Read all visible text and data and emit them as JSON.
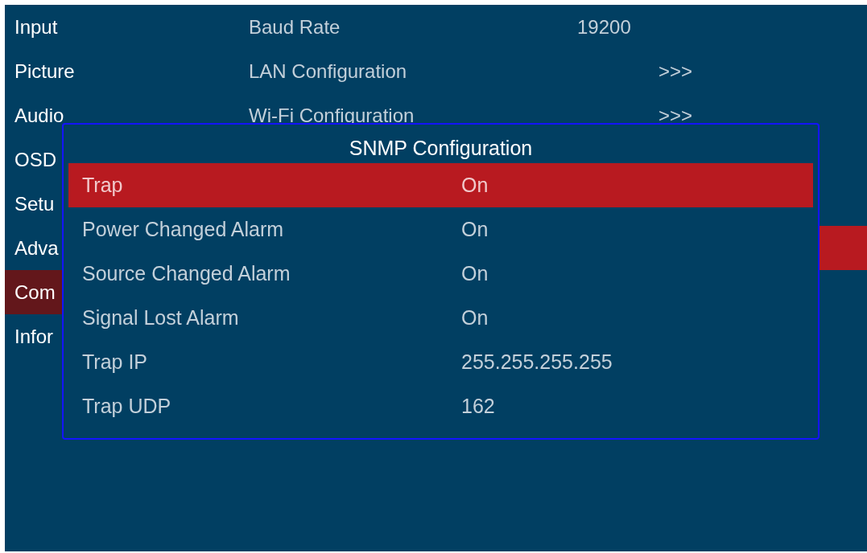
{
  "menu": [
    {
      "label": "Input",
      "selected": false
    },
    {
      "label": "Picture",
      "selected": false
    },
    {
      "label": "Audio",
      "selected": false
    },
    {
      "label": "OSD",
      "selected": false
    },
    {
      "label": "Setu",
      "selected": false
    },
    {
      "label": "Adva",
      "selected": false
    },
    {
      "label": "Com",
      "selected": true
    },
    {
      "label": "Infor",
      "selected": false
    }
  ],
  "settings": {
    "rows": [
      {
        "label": "Baud Rate",
        "value": "19200",
        "kind": "value"
      },
      {
        "label": "LAN Configuration",
        "value": ">>>",
        "kind": "link"
      },
      {
        "label": "Wi-Fi Configuration",
        "value": ">>>",
        "kind": "link"
      }
    ],
    "covered_row": {
      "selected": true
    }
  },
  "dialog": {
    "title": "SNMP Configuration",
    "rows": [
      {
        "label": "Trap",
        "value": "On",
        "selected": true
      },
      {
        "label": "Power Changed Alarm",
        "value": "On",
        "selected": false
      },
      {
        "label": "Source Changed Alarm",
        "value": "On",
        "selected": false
      },
      {
        "label": "Signal Lost Alarm",
        "value": "On",
        "selected": false
      },
      {
        "label": "Trap IP",
        "value": "255.255.255.255",
        "selected": false
      },
      {
        "label": "Trap UDP",
        "value": "162",
        "selected": false
      }
    ]
  }
}
